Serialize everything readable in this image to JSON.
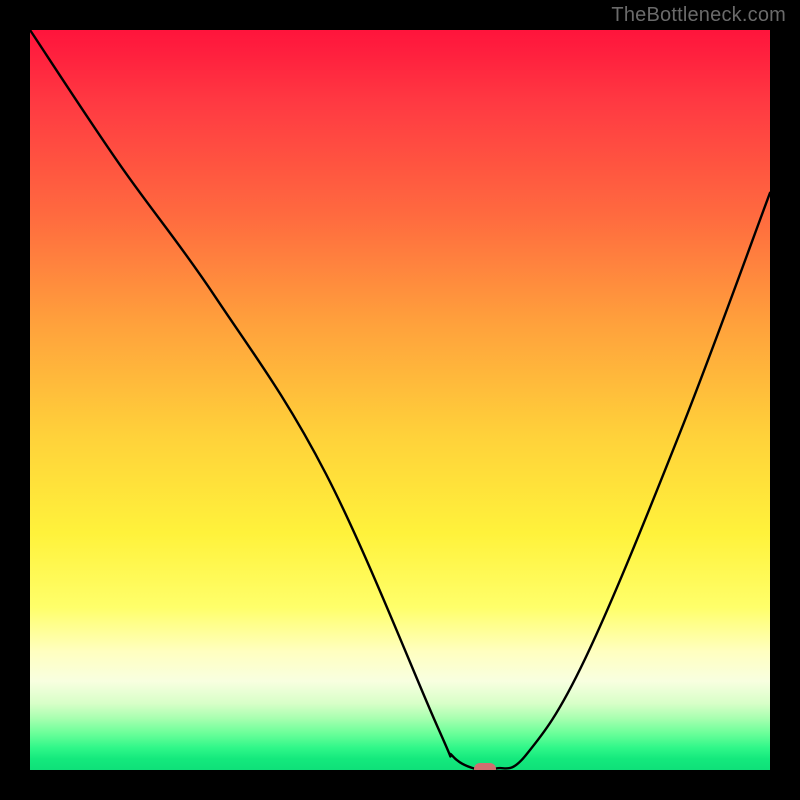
{
  "watermark": "TheBottleneck.com",
  "chart_data": {
    "type": "line",
    "title": "",
    "xlabel": "",
    "ylabel": "",
    "xlim": [
      0,
      100
    ],
    "ylim": [
      0,
      100
    ],
    "x": [
      0,
      12,
      25,
      40,
      55,
      57,
      60,
      63,
      67,
      75,
      88,
      100
    ],
    "values": [
      100,
      82,
      64,
      40,
      6,
      2,
      0.2,
      0.2,
      2,
      15,
      46,
      78
    ],
    "marker": {
      "x": 61.5,
      "y": 0.2
    },
    "background_gradient": {
      "top": "#ff143c",
      "mid": "#ffe33b",
      "bottom": "#0fe079"
    }
  }
}
